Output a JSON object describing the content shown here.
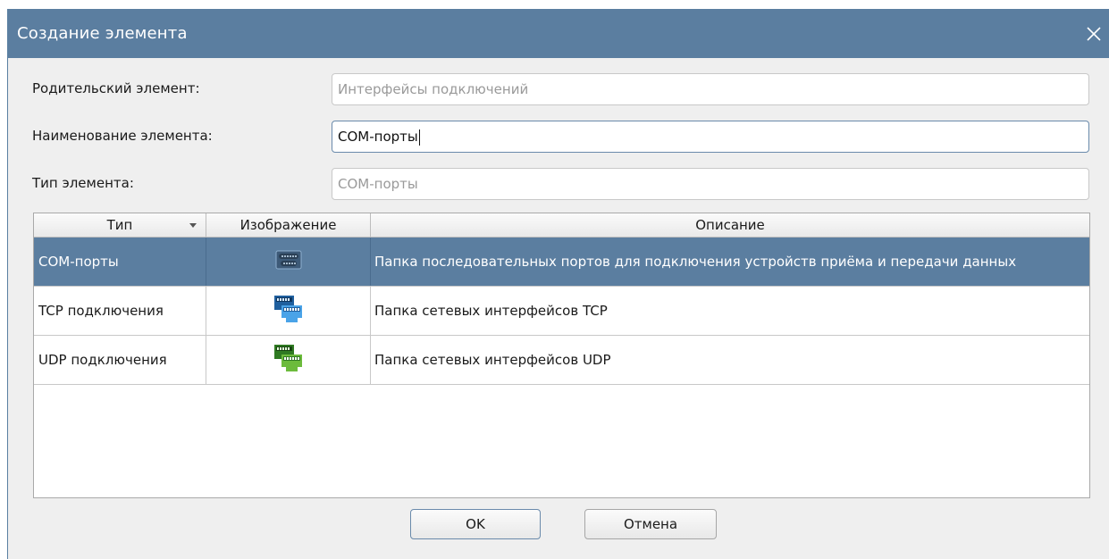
{
  "dialog": {
    "title": "Создание элемента",
    "close_icon": "close-icon"
  },
  "form": {
    "parent_label": "Родительский элемент:",
    "parent_value": "Интерфейсы подключений",
    "name_label": "Наименование элемента:",
    "name_value": "COM-порты",
    "type_label": "Тип элемента:",
    "type_value": "COM-порты"
  },
  "table": {
    "columns": [
      "Тип",
      "Изображение",
      "Описание"
    ],
    "rows": [
      {
        "type": "COM-порты",
        "icon": "serial-port-icon",
        "description": "Папка последовательных портов для подключения устройств приёма и передачи данных",
        "selected": true
      },
      {
        "type": "TCP подключения",
        "icon": "network-tcp-icon",
        "description": "Папка сетевых интерфейсов TCP",
        "selected": false
      },
      {
        "type": "UDP подключения",
        "icon": "network-udp-icon",
        "description": "Папка сетевых интерфейсов UDP",
        "selected": false
      }
    ]
  },
  "buttons": {
    "ok": "OK",
    "cancel": "Отмена"
  },
  "colors": {
    "accent": "#5b7ea0",
    "tcp_icon": "#3a8fd4",
    "udp_icon": "#5aa83c"
  }
}
